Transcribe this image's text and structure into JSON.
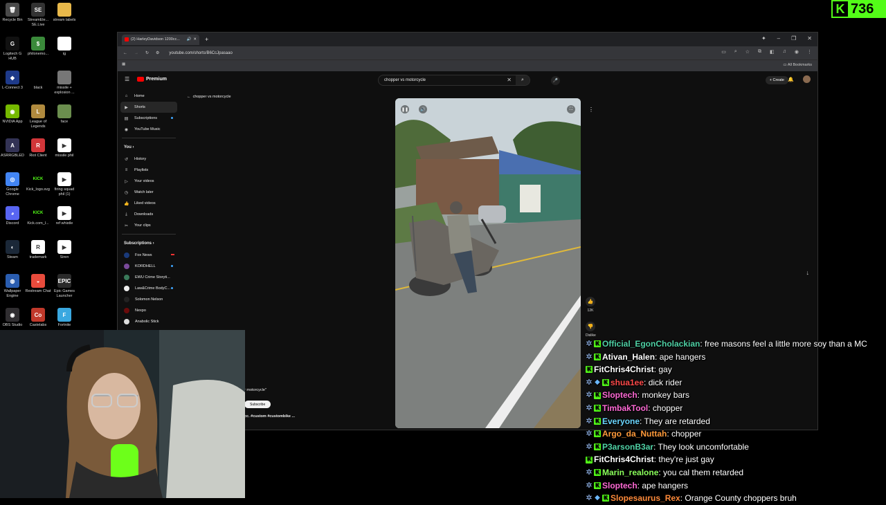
{
  "desktop": {
    "icons": [
      {
        "label": "Recycle Bin",
        "icon": "recycle-bin-icon",
        "glyph": "🗑",
        "color": "#4a4a4a"
      },
      {
        "label": "StreamEle... SE.Live",
        "icon": "streamelements-icon",
        "glyph": "SE",
        "color": "#333333"
      },
      {
        "label": "stream labels",
        "icon": "folder-icon",
        "glyph": "",
        "color": "#e8b84a"
      },
      {
        "label": "Logitech G HUB",
        "icon": "logitech-icon",
        "glyph": "G",
        "color": "#111111"
      },
      {
        "label": "philonemo...",
        "icon": "money-icon",
        "glyph": "$",
        "color": "#3a8a3a"
      },
      {
        "label": "ig",
        "icon": "text-file-icon",
        "glyph": "",
        "color": "#ffffff"
      },
      {
        "label": "L-Connect 3",
        "icon": "lconnect-icon",
        "glyph": "◆",
        "color": "#1e3a8a"
      },
      {
        "label": "black",
        "icon": "black-image-icon",
        "glyph": "",
        "color": "#000000"
      },
      {
        "label": "missile + explosion ...",
        "icon": "video-file-icon",
        "glyph": "",
        "color": "#777777"
      },
      {
        "label": "NVIDIA App",
        "icon": "nvidia-icon",
        "glyph": "◉",
        "color": "#76b900"
      },
      {
        "label": "League of Legends",
        "icon": "league-icon",
        "glyph": "L",
        "color": "#b08a3e"
      },
      {
        "label": "face",
        "icon": "face-image-icon",
        "glyph": "",
        "color": "#6b8e4e"
      },
      {
        "label": "ASRRGBLED",
        "icon": "asrock-icon",
        "glyph": "A",
        "color": "#333355"
      },
      {
        "label": "Riot Client",
        "icon": "riot-icon",
        "glyph": "R",
        "color": "#d13639"
      },
      {
        "label": "missile phil",
        "icon": "media-file-icon",
        "glyph": "▶",
        "color": "#ffffff"
      },
      {
        "label": "Google Chrome",
        "icon": "chrome-icon",
        "glyph": "◎",
        "color": "#4285f4"
      },
      {
        "label": "Kick_logo.svg",
        "icon": "kick-logo-icon",
        "glyph": "KICK",
        "color": "#000000"
      },
      {
        "label": "firing squad phil (1)",
        "icon": "media-file-icon",
        "glyph": "▶",
        "color": "#ffffff"
      },
      {
        "label": "Discord",
        "icon": "discord-icon",
        "glyph": "◕",
        "color": "#5865f2"
      },
      {
        "label": "Kick.com_l...",
        "icon": "kick-logo-icon",
        "glyph": "KICK",
        "color": "#000000"
      },
      {
        "label": "ref whistle",
        "icon": "media-file-icon",
        "glyph": "▶",
        "color": "#ffffff"
      },
      {
        "label": "Steam",
        "icon": "steam-icon",
        "glyph": "◐",
        "color": "#1b2838"
      },
      {
        "label": "trademark",
        "icon": "trademark-icon",
        "glyph": "R",
        "color": "#ffffff"
      },
      {
        "label": "Siren",
        "icon": "media-file-icon",
        "glyph": "▶",
        "color": "#ffffff"
      },
      {
        "label": "Wallpaper Engine",
        "icon": "wallpaper-engine-icon",
        "glyph": "◍",
        "color": "#2a5db0"
      },
      {
        "label": "Restream Chat",
        "icon": "restream-icon",
        "glyph": "◒",
        "color": "#e84b3c"
      },
      {
        "label": "Epic Games Launcher",
        "icon": "epic-games-icon",
        "glyph": "EPIC",
        "color": "#2a2a2a"
      },
      {
        "label": "OBS Studio",
        "icon": "obs-icon",
        "glyph": "◉",
        "color": "#302e31"
      },
      {
        "label": "Castelabs",
        "icon": "castelabs-icon",
        "glyph": "Co",
        "color": "#c0392b"
      },
      {
        "label": "Fortnite",
        "icon": "fortnite-icon",
        "glyph": "F",
        "color": "#3aa8e0"
      }
    ]
  },
  "kick": {
    "count": "736"
  },
  "browser": {
    "tab_title": "(2) HarleyDavidson 1200cc...",
    "url": "youtube.com/shorts/B6CcJpasaao",
    "all_bookmarks": "All Bookmarks"
  },
  "youtube": {
    "logo": "Premium",
    "search_value": "chopper vs motorcycle",
    "create": "Create",
    "back_label": "chopper vs motorcycle",
    "nav": [
      {
        "label": "Home",
        "icon": "home-icon",
        "glyph": "⌂"
      },
      {
        "label": "Shorts",
        "icon": "shorts-icon",
        "glyph": "▶"
      },
      {
        "label": "Subscriptions",
        "icon": "subscriptions-icon",
        "glyph": "▤"
      },
      {
        "label": "YouTube Music",
        "icon": "music-icon",
        "glyph": "◉"
      }
    ],
    "you_header": "You",
    "you_items": [
      {
        "label": "History",
        "icon": "history-icon",
        "glyph": "↺"
      },
      {
        "label": "Playlists",
        "icon": "playlists-icon",
        "glyph": "≡"
      },
      {
        "label": "Your videos",
        "icon": "your-videos-icon",
        "glyph": "▷"
      },
      {
        "label": "Watch later",
        "icon": "watch-later-icon",
        "glyph": "◷"
      },
      {
        "label": "Liked videos",
        "icon": "liked-icon",
        "glyph": "👍"
      },
      {
        "label": "Downloads",
        "icon": "downloads-icon",
        "glyph": "⤓"
      },
      {
        "label": "Your clips",
        "icon": "clips-icon",
        "glyph": "✂"
      }
    ],
    "subs_header": "Subscriptions",
    "subs": [
      {
        "label": "Fox News",
        "color": "#1a3a7a"
      },
      {
        "label": "KORDHELL",
        "color": "#7a4a9a"
      },
      {
        "label": "EWU Crime Storyti...",
        "color": "#3a7a5a"
      },
      {
        "label": "Law&Crime BodyC...",
        "color": "#eeeeee"
      },
      {
        "label": "Solomon Nelson",
        "color": "#222222"
      },
      {
        "label": "Nexpo",
        "color": "#6a0a0a"
      },
      {
        "label": "Anabolic Stick",
        "color": "#dddddd"
      }
    ],
    "likes": "12K",
    "dislike": "Dislike",
    "meta_query": "r motorcycle\"",
    "subscribe": "Subscribe",
    "description": "cc. #custom #custombike ..."
  },
  "chat": [
    {
      "user": "Official_EgonCholackian",
      "color": "#4fd1a5",
      "badges": [
        "v",
        "k"
      ],
      "text": ": free masons feel a little more soy than a MC"
    },
    {
      "user": "Ativan_Halen",
      "color": "#ffffff",
      "badges": [
        "v",
        "k"
      ],
      "text": ": ape hangers"
    },
    {
      "user": "FitChris4Christ",
      "color": "#ffffff",
      "badges": [
        "k"
      ],
      "text": ": gay"
    },
    {
      "user": "shua1ee",
      "color": "#ff4a4a",
      "badges": [
        "v",
        "m",
        "k"
      ],
      "text": ": dick rider"
    },
    {
      "user": "Sloptech",
      "color": "#ff6ad5",
      "badges": [
        "v",
        "k"
      ],
      "text": ": monkey bars"
    },
    {
      "user": "TimbakTool",
      "color": "#ff6ad5",
      "badges": [
        "v",
        "k"
      ],
      "text": ": chopper"
    },
    {
      "user": "Everyone",
      "color": "#6bd6ff",
      "badges": [
        "v",
        "k"
      ],
      "text": ": They are retarded"
    },
    {
      "user": "Argo_da_Nuttah",
      "color": "#ff9a3a",
      "badges": [
        "v",
        "k"
      ],
      "text": ": chopper"
    },
    {
      "user": "P3arsonB3ar",
      "color": "#4fd1a5",
      "badges": [
        "v",
        "k"
      ],
      "text": ": They look uncomfortable"
    },
    {
      "user": "FitChris4Christ",
      "color": "#ffffff",
      "badges": [
        "k"
      ],
      "text": ": they're just gay"
    },
    {
      "user": "Marin_realone",
      "color": "#8aff5a",
      "badges": [
        "v",
        "k"
      ],
      "text": ": you cal them retarded"
    },
    {
      "user": "Sloptech",
      "color": "#ff6ad5",
      "badges": [
        "v",
        "k"
      ],
      "text": ": ape hangers"
    },
    {
      "user": "Slopesaurus_Rex",
      "color": "#ff8a3a",
      "badges": [
        "v",
        "m",
        "k"
      ],
      "text": ": Orange County choppers bruh"
    }
  ]
}
